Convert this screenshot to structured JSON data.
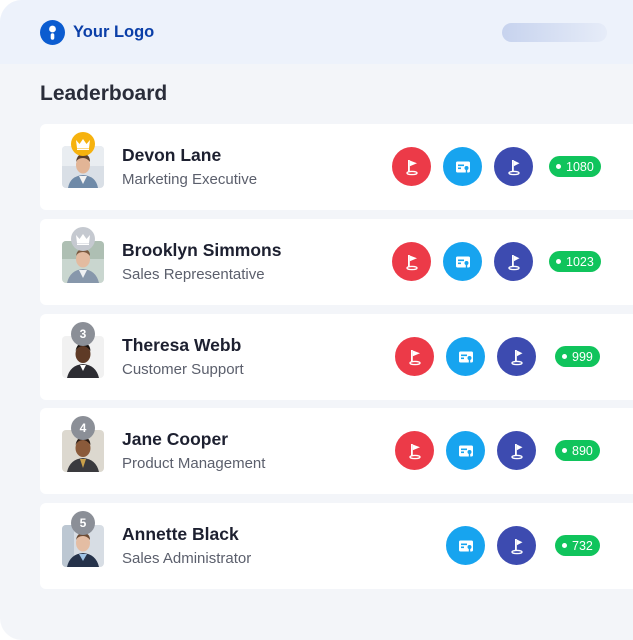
{
  "brand": {
    "logo_text": "Your Logo"
  },
  "page": {
    "title": "Leaderboard"
  },
  "colors": {
    "flag_red": "#ec3a48",
    "card_cyan": "#17a4ef",
    "flag_indigo": "#3d4bb0",
    "score_green": "#10c45c",
    "gold": "#f6b20e",
    "silver": "#c5c9d0"
  },
  "entries": [
    {
      "rank": "1",
      "rank_badge": "crown-gold",
      "name": "Devon Lane",
      "role": "Marketing Executive",
      "score": "1080",
      "achievements": [
        "red-flag-icon",
        "id-card-icon",
        "indigo-flag-icon"
      ]
    },
    {
      "rank": "2",
      "rank_badge": "crown-silver",
      "name": "Brooklyn Simmons",
      "role": "Sales Representative",
      "score": "1023",
      "achievements": [
        "red-flag-icon",
        "id-card-icon",
        "indigo-flag-icon"
      ]
    },
    {
      "rank": "3",
      "rank_badge": "number",
      "name": "Theresa Webb",
      "role": "Customer Support",
      "score": "999",
      "achievements": [
        "red-flag-icon",
        "id-card-icon",
        "indigo-flag-icon"
      ]
    },
    {
      "rank": "4",
      "rank_badge": "number",
      "name": "Jane Cooper",
      "role": "Product Management",
      "score": "890",
      "achievements": [
        "red-flag-icon",
        "id-card-icon",
        "indigo-flag-icon"
      ]
    },
    {
      "rank": "5",
      "rank_badge": "number",
      "name": "Annette Black",
      "role": "Sales Administrator",
      "score": "732",
      "achievements": [
        "id-card-icon",
        "indigo-flag-icon"
      ]
    }
  ]
}
